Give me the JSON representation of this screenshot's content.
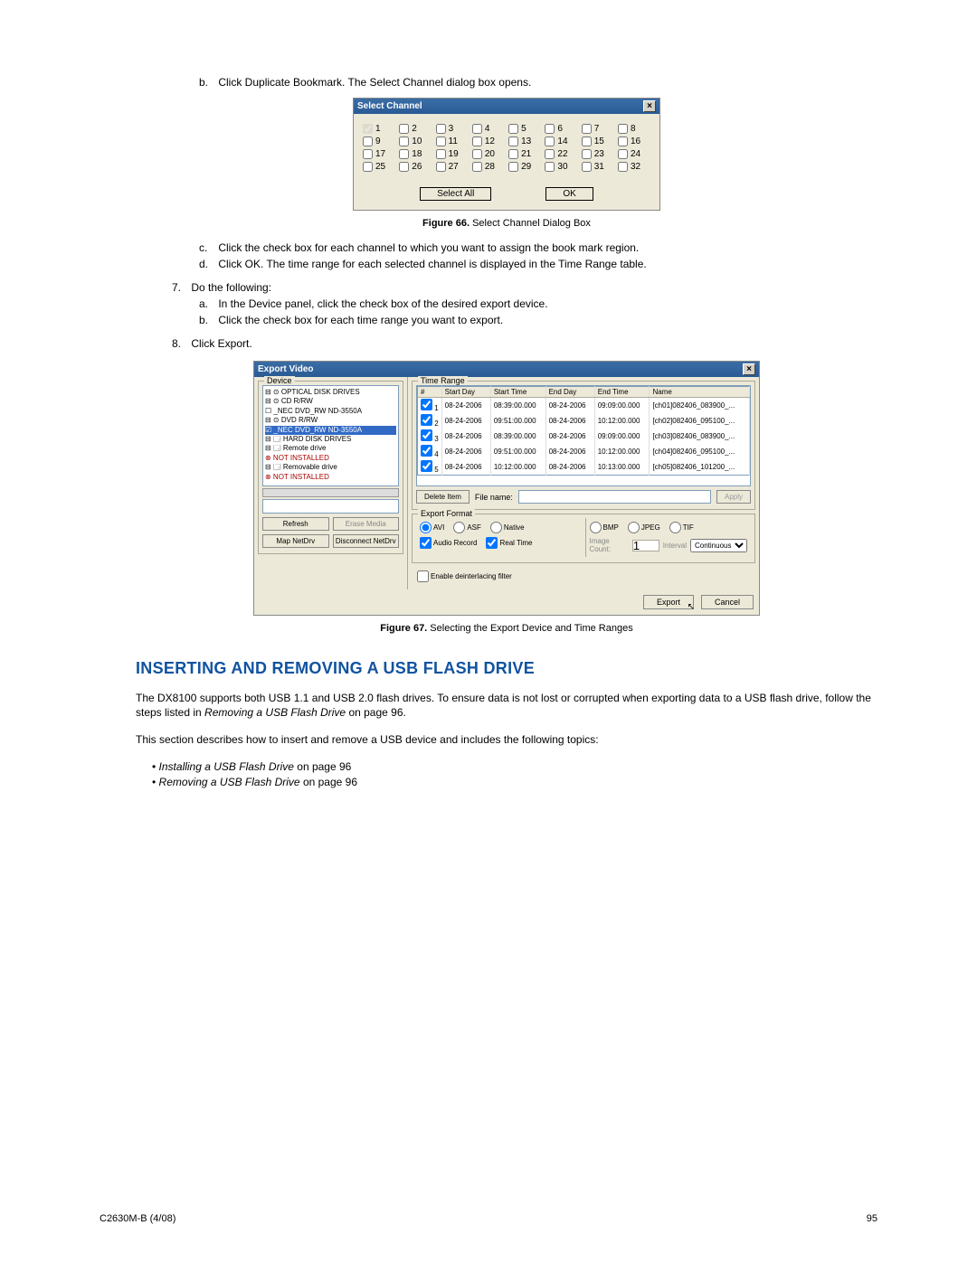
{
  "intro_step_b": {
    "label": "b.",
    "text": "Click Duplicate Bookmark. The Select Channel dialog box opens."
  },
  "select_channel": {
    "title": "Select Channel",
    "close": "×",
    "rows": [
      [
        {
          "n": "1",
          "checked": true,
          "disabled": true
        },
        {
          "n": "2"
        },
        {
          "n": "3"
        },
        {
          "n": "4"
        },
        {
          "n": "5"
        },
        {
          "n": "6"
        },
        {
          "n": "7"
        },
        {
          "n": "8"
        }
      ],
      [
        {
          "n": "9"
        },
        {
          "n": "10"
        },
        {
          "n": "11"
        },
        {
          "n": "12"
        },
        {
          "n": "13"
        },
        {
          "n": "14"
        },
        {
          "n": "15"
        },
        {
          "n": "16"
        }
      ],
      [
        {
          "n": "17"
        },
        {
          "n": "18"
        },
        {
          "n": "19"
        },
        {
          "n": "20"
        },
        {
          "n": "21"
        },
        {
          "n": "22"
        },
        {
          "n": "23"
        },
        {
          "n": "24"
        }
      ],
      [
        {
          "n": "25"
        },
        {
          "n": "26"
        },
        {
          "n": "27"
        },
        {
          "n": "28"
        },
        {
          "n": "29"
        },
        {
          "n": "30"
        },
        {
          "n": "31"
        },
        {
          "n": "32"
        }
      ]
    ],
    "select_all": "Select All",
    "ok": "OK"
  },
  "caption66": {
    "prefix": "Figure 66.",
    "text": "  Select Channel Dialog Box"
  },
  "step_c": {
    "label": "c.",
    "text": "Click the check box for each channel to which you want to assign the book mark region."
  },
  "step_d": {
    "label": "d.",
    "text": "Click OK. The time range for each selected channel is displayed in the Time Range table."
  },
  "step7": {
    "label": "7.",
    "text": "Do the following:"
  },
  "step7a": {
    "label": "a.",
    "text": "In the Device panel, click the check box of the desired export device."
  },
  "step7b": {
    "label": "b.",
    "text": "Click the check box for each time range you want to export."
  },
  "step8": {
    "label": "8.",
    "text": "Click Export."
  },
  "export_video": {
    "title": "Export Video",
    "close": "×",
    "device_legend": "Device",
    "tree": [
      "⊟ ⊙ OPTICAL DISK DRIVES",
      "  ⊟ ⊙ CD R/RW",
      "      ☐  _NEC    DVD_RW ND-3550A",
      "  ⊟ ⊙ DVD R/RW",
      "      ☑  _NEC    DVD_RW ND-3550A",
      "⊟ 🗔 HARD DISK DRIVES",
      "  ⊟ 🗔 Remote drive",
      "      ⊗  NOT INSTALLED",
      "  ⊟ 🗔 Removable drive",
      "      ⊗  NOT INSTALLED"
    ],
    "refresh": "Refresh",
    "erase": "Erase Media",
    "map": "Map NetDrv",
    "disconnect": "Disconnect NetDrv",
    "time_legend": "Time Range",
    "headers": [
      "#",
      "Start Day",
      "Start Time",
      "End Day",
      "End Time",
      "Name"
    ],
    "rows": [
      {
        "n": "1",
        "sd": "08-24-2006",
        "st": "08:39:00.000",
        "ed": "08-24-2006",
        "et": "09:09:00.000",
        "name": "[ch01]082406_083900_..."
      },
      {
        "n": "2",
        "sd": "08-24-2006",
        "st": "09:51:00.000",
        "ed": "08-24-2006",
        "et": "10:12:00.000",
        "name": "[ch02]082406_095100_..."
      },
      {
        "n": "3",
        "sd": "08-24-2006",
        "st": "08:39:00.000",
        "ed": "08-24-2006",
        "et": "09:09:00.000",
        "name": "[ch03]082406_083900_..."
      },
      {
        "n": "4",
        "sd": "08-24-2006",
        "st": "09:51:00.000",
        "ed": "08-24-2006",
        "et": "10:12:00.000",
        "name": "[ch04]082406_095100_..."
      },
      {
        "n": "5",
        "sd": "08-24-2006",
        "st": "10:12:00.000",
        "ed": "08-24-2006",
        "et": "10:13:00.000",
        "name": "[ch05]082406_101200_..."
      }
    ],
    "delete_item": "Delete Item",
    "file_name_label": "File name:",
    "apply": "Apply",
    "ef_legend": "Export Format",
    "radios_left": [
      "AVI",
      "ASF",
      "Native"
    ],
    "cb_left": [
      "Audio Record",
      "Real Time"
    ],
    "radios_right": [
      "BMP",
      "JPEG",
      "TIF"
    ],
    "image_count": "Image Count:",
    "interval": "Interval",
    "continuous": "Continuous",
    "deinterlace": "Enable deinterlacing filter",
    "export_btn": "Export",
    "cancel_btn": "Cancel"
  },
  "caption67": {
    "prefix": "Figure 67.",
    "text": "  Selecting the Export Device and Time Ranges"
  },
  "heading": "INSERTING AND REMOVING A USB FLASH DRIVE",
  "para1_a": "The DX8100 supports both USB 1.1 and USB 2.0 flash drives. To ensure data is not lost or corrupted when exporting data to a USB flash drive, follow the steps listed in ",
  "para1_italic": "Removing a USB Flash Drive",
  "para1_b": " on page 96.",
  "para2": "This section describes how to insert and remove a USB device and includes the following topics:",
  "bullets": [
    {
      "italic": "Installing a USB Flash Drive",
      "tail": " on page 96"
    },
    {
      "italic": "Removing a USB Flash Drive",
      "tail": " on page 96"
    }
  ],
  "footer_left": "C2630M-B (4/08)",
  "footer_right": "95"
}
